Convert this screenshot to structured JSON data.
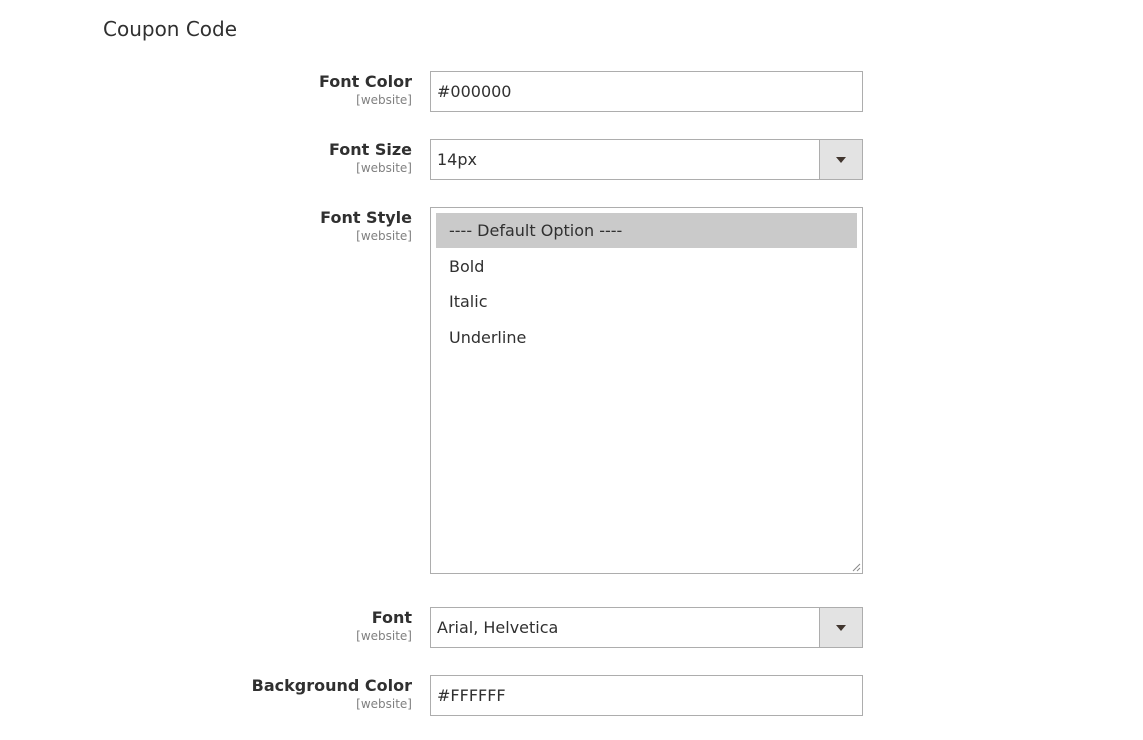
{
  "section": {
    "title": "Coupon Code"
  },
  "fields": {
    "font_color": {
      "label": "Font Color",
      "scope": "[website]",
      "value": "#000000"
    },
    "font_size": {
      "label": "Font Size",
      "scope": "[website]",
      "value": "14px"
    },
    "font_style": {
      "label": "Font Style",
      "scope": "[website]",
      "options": [
        "---- Default Option ----",
        "Bold",
        "Italic",
        "Underline"
      ],
      "selected_index": 0
    },
    "font": {
      "label": "Font",
      "scope": "[website]",
      "value": "Arial, Helvetica"
    },
    "background_color": {
      "label": "Background Color",
      "scope": "[website]",
      "value": "#FFFFFF"
    }
  },
  "colors": {
    "selected_option_bg": "#cacaca",
    "select_button_bg": "#e3e3e3",
    "border": "#adadad",
    "scope_text": "#808080"
  },
  "icons": {
    "select_arrow": "chevron-down-icon",
    "resize": "resize-grip-icon"
  }
}
